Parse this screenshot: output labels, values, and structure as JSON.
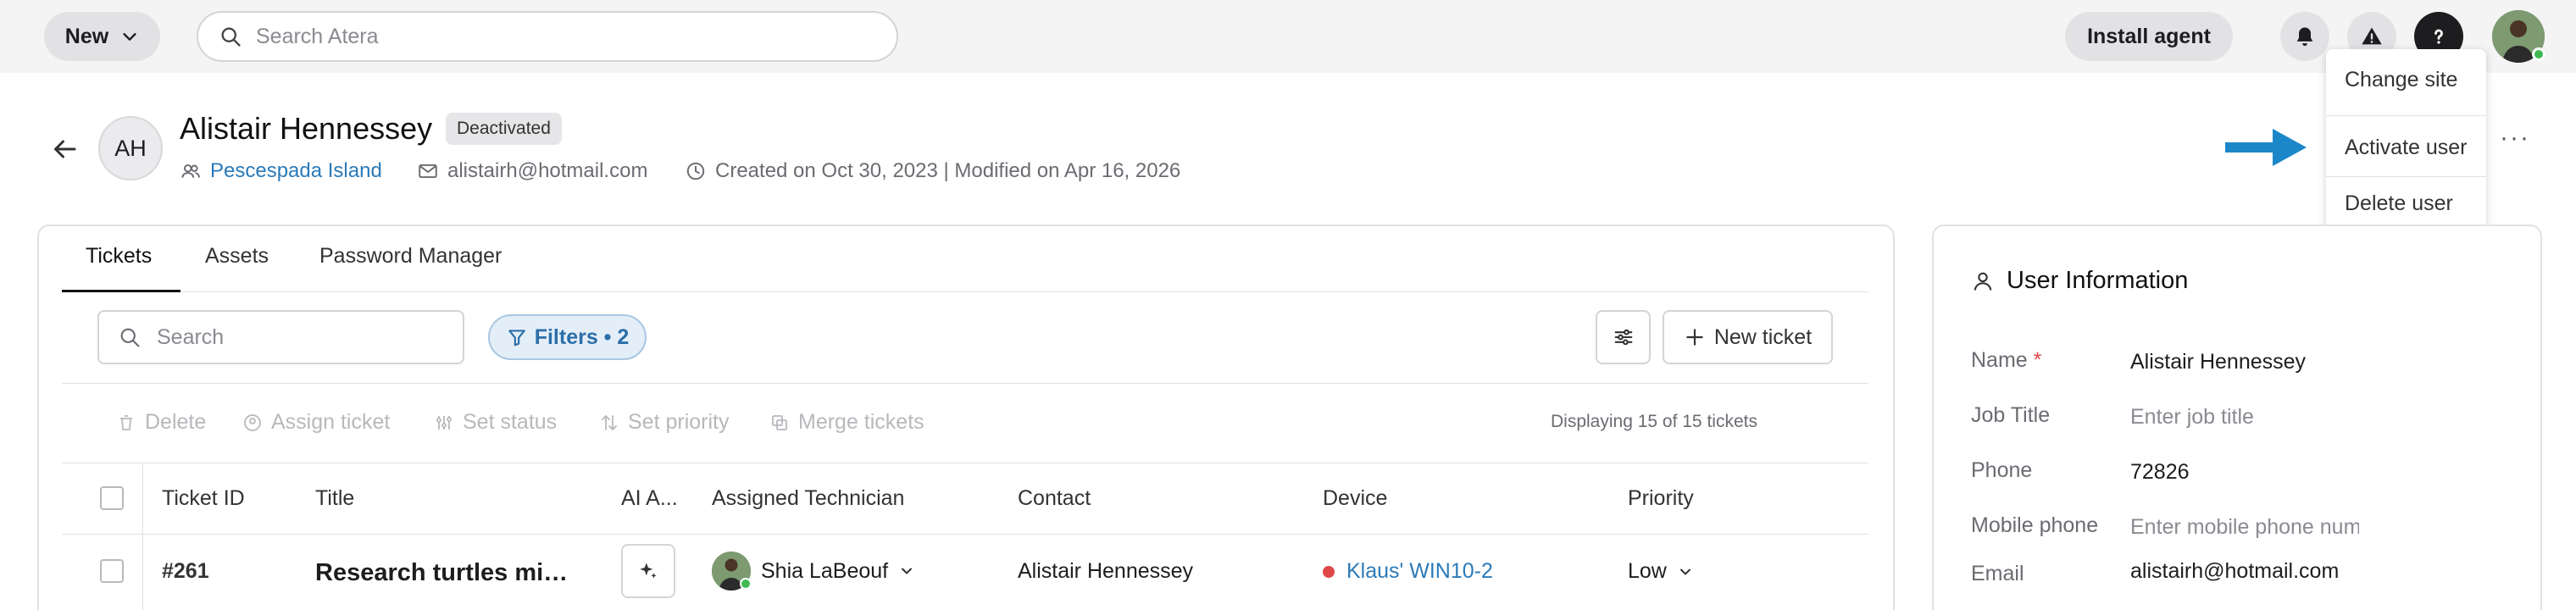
{
  "topbar": {
    "new_label": "New",
    "search_placeholder": "Search Atera",
    "install_agent_label": "Install agent"
  },
  "user": {
    "initials": "AH",
    "name": "Alistair Hennessey",
    "status": "Deactivated",
    "site": "Pescespada Island",
    "email": "alistairh@hotmail.com",
    "created_modified": "Created on Oct 30, 2023 | Modified on Apr 16, 2026"
  },
  "dropdown": {
    "items": [
      "Change site",
      "Activate user",
      "Delete user"
    ]
  },
  "more_label": "···",
  "tabs": [
    "Tickets",
    "Assets",
    "Password Manager"
  ],
  "toolbar": {
    "search_placeholder": "Search",
    "filters_label": "Filters • 2",
    "new_ticket_label": "New ticket"
  },
  "actions": [
    "Delete",
    "Assign ticket",
    "Set status",
    "Set priority",
    "Merge tickets"
  ],
  "displaying": "Displaying 15 of 15 tickets",
  "table": {
    "headers": [
      "Ticket ID",
      "Title",
      "AI A...",
      "Assigned Technician",
      "Contact",
      "Device",
      "Priority"
    ],
    "rows": [
      {
        "ticket_id": "#261",
        "title": "Research turtles missing from Pescespada",
        "technician": "Shia LaBeouf",
        "contact": "Alistair Hennessey",
        "device": "Klaus' WIN10-2",
        "priority": "Low"
      }
    ]
  },
  "info": {
    "title": "User Information",
    "fields": [
      {
        "label": "Name",
        "value": "Alistair Hennessey"
      },
      {
        "label": "Job Title",
        "placeholder": "Enter job title"
      },
      {
        "label": "Phone",
        "value": "72826"
      },
      {
        "label": "Mobile phone",
        "placeholder": "Enter mobile phone number"
      },
      {
        "label": "Email",
        "value": "alistairh@hotmail.com"
      }
    ],
    "required_mark": "*"
  },
  "colors": {
    "accent_blue": "#2b7ab8",
    "arrow_blue": "#1b87c9",
    "status_red": "#e04848",
    "online_green": "#3fb950"
  }
}
